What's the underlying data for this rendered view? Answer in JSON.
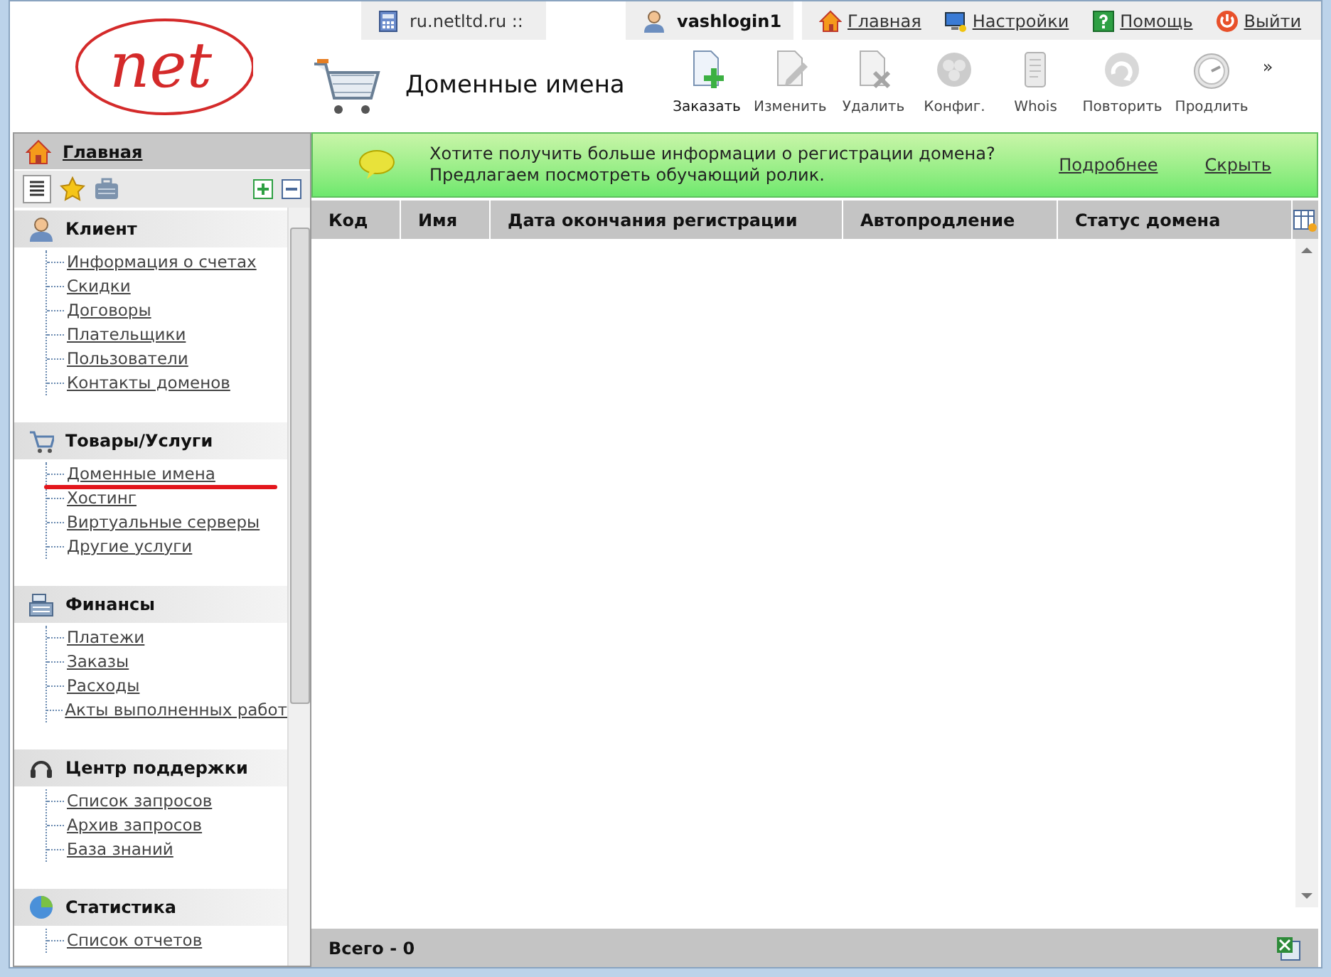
{
  "logo": {
    "text": "net"
  },
  "top_bar": {
    "site": "ru.netltd.ru ::",
    "user": "vashlogin1",
    "links": [
      {
        "kind": "home",
        "label": "Главная"
      },
      {
        "kind": "settings",
        "label": "Настройки"
      },
      {
        "kind": "help",
        "label": "Помощь"
      },
      {
        "kind": "logout",
        "label": "Выйти"
      }
    ]
  },
  "page_title": "Доменные имена",
  "toolbar": [
    {
      "kind": "order",
      "label": "Заказать",
      "disabled": false
    },
    {
      "kind": "edit",
      "label": "Изменить",
      "disabled": true
    },
    {
      "kind": "delete",
      "label": "Удалить",
      "disabled": true
    },
    {
      "kind": "config",
      "label": "Конфиг.",
      "disabled": true
    },
    {
      "kind": "whois",
      "label": "Whois",
      "disabled": true
    },
    {
      "kind": "repeat",
      "label": "Повторить",
      "disabled": true
    },
    {
      "kind": "renew",
      "label": "Продлить",
      "disabled": true
    }
  ],
  "toolbar_more": "»",
  "sidebar": {
    "home": "Главная",
    "sections": [
      {
        "kind": "client",
        "title": "Клиент",
        "items": [
          {
            "label": "Информация о счетах",
            "underlined": false
          },
          {
            "label": "Скидки",
            "underlined": false
          },
          {
            "label": "Договоры",
            "underlined": false
          },
          {
            "label": "Плательщики",
            "underlined": false
          },
          {
            "label": "Пользователи",
            "underlined": false
          },
          {
            "label": "Контакты доменов",
            "underlined": false
          }
        ]
      },
      {
        "kind": "cart",
        "title": "Товары/Услуги",
        "items": [
          {
            "label": "Доменные имена",
            "underlined": true
          },
          {
            "label": "Хостинг",
            "underlined": false
          },
          {
            "label": "Виртуальные серверы",
            "underlined": false
          },
          {
            "label": "Другие услуги",
            "underlined": false
          }
        ]
      },
      {
        "kind": "finance",
        "title": "Финансы",
        "items": [
          {
            "label": "Платежи",
            "underlined": false
          },
          {
            "label": "Заказы",
            "underlined": false
          },
          {
            "label": "Расходы",
            "underlined": false
          },
          {
            "label": "Акты выполненных работ",
            "underlined": false
          }
        ]
      },
      {
        "kind": "support",
        "title": "Центр поддержки",
        "items": [
          {
            "label": "Список запросов",
            "underlined": false
          },
          {
            "label": "Архив запросов",
            "underlined": false
          },
          {
            "label": "База знаний",
            "underlined": false
          }
        ]
      },
      {
        "kind": "stats",
        "title": "Статистика",
        "items": [
          {
            "label": "Список отчетов",
            "underlined": false
          }
        ]
      }
    ]
  },
  "banner": {
    "lines": [
      "Хотите получить больше информации о регистрации домена?",
      "Предлагаем посмотреть обучающий ролик."
    ],
    "links": [
      "Подробнее",
      "Скрыть"
    ]
  },
  "table": {
    "columns": [
      "Код",
      "Имя",
      "Дата окончания регистрации",
      "Автопродление",
      "Статус домена"
    ]
  },
  "footer": {
    "total": "Всего - 0"
  }
}
